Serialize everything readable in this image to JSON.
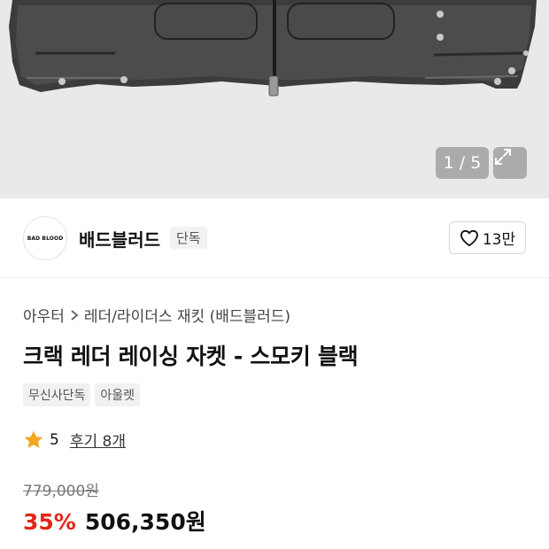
{
  "gallery": {
    "counter": "1 / 5",
    "expand_icon": "expand-icon"
  },
  "brand": {
    "logo_text": "BAD BLOOD",
    "name": "배드블러드",
    "exclusive_badge": "단독"
  },
  "like": {
    "icon": "heart-icon",
    "count": "13만"
  },
  "breadcrumb": {
    "category": "아우터",
    "subcategory": "레더/라이더스 재킷 (배드블러드)"
  },
  "product": {
    "title": "크랙 레더 레이싱 자켓 - 스모키 블랙",
    "tags": [
      "무신사단독",
      "아울렛"
    ]
  },
  "rating": {
    "icon": "star-icon",
    "score": "5",
    "reviews": "후기 8개",
    "star_color": "#f5a623"
  },
  "price": {
    "original": "779,000원",
    "discount": "35%",
    "sale": "506,350원",
    "discount_color": "#e0271a"
  }
}
